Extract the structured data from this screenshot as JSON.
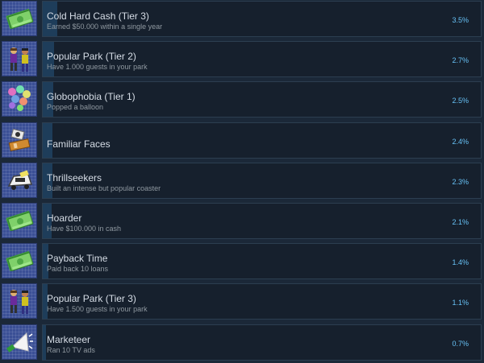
{
  "achievements": [
    {
      "title": "Cold Hard Cash (Tier 3)",
      "description": "Earned $50.000 within a single year",
      "percent_label": "3.5%",
      "percent": 3.5,
      "icon": "cash-icon"
    },
    {
      "title": "Popular Park (Tier 2)",
      "description": "Have 1.000 guests in your park",
      "percent_label": "2.7%",
      "percent": 2.7,
      "icon": "guests-icon"
    },
    {
      "title": "Globophobia (Tier 1)",
      "description": "Popped a balloon",
      "percent_label": "2.5%",
      "percent": 2.5,
      "icon": "balloons-icon"
    },
    {
      "title": "Familiar Faces",
      "description": "",
      "percent_label": "2.4%",
      "percent": 2.4,
      "icon": "ride-photo-icon"
    },
    {
      "title": "Thrillseekers",
      "description": "Built an intense but popular coaster",
      "percent_label": "2.3%",
      "percent": 2.3,
      "icon": "coaster-car-icon"
    },
    {
      "title": "Hoarder",
      "description": "Have $100.000 in cash",
      "percent_label": "2.1%",
      "percent": 2.1,
      "icon": "cash-icon"
    },
    {
      "title": "Payback Time",
      "description": "Paid back 10 loans",
      "percent_label": "1.4%",
      "percent": 1.4,
      "icon": "cash-icon"
    },
    {
      "title": "Popular Park (Tier 3)",
      "description": "Have 1.500 guests in your park",
      "percent_label": "1.1%",
      "percent": 1.1,
      "icon": "guests-icon"
    },
    {
      "title": "Marketeer",
      "description": "Ran 10 TV ads",
      "percent_label": "0.7%",
      "percent": 0.7,
      "icon": "megaphone-icon"
    }
  ]
}
